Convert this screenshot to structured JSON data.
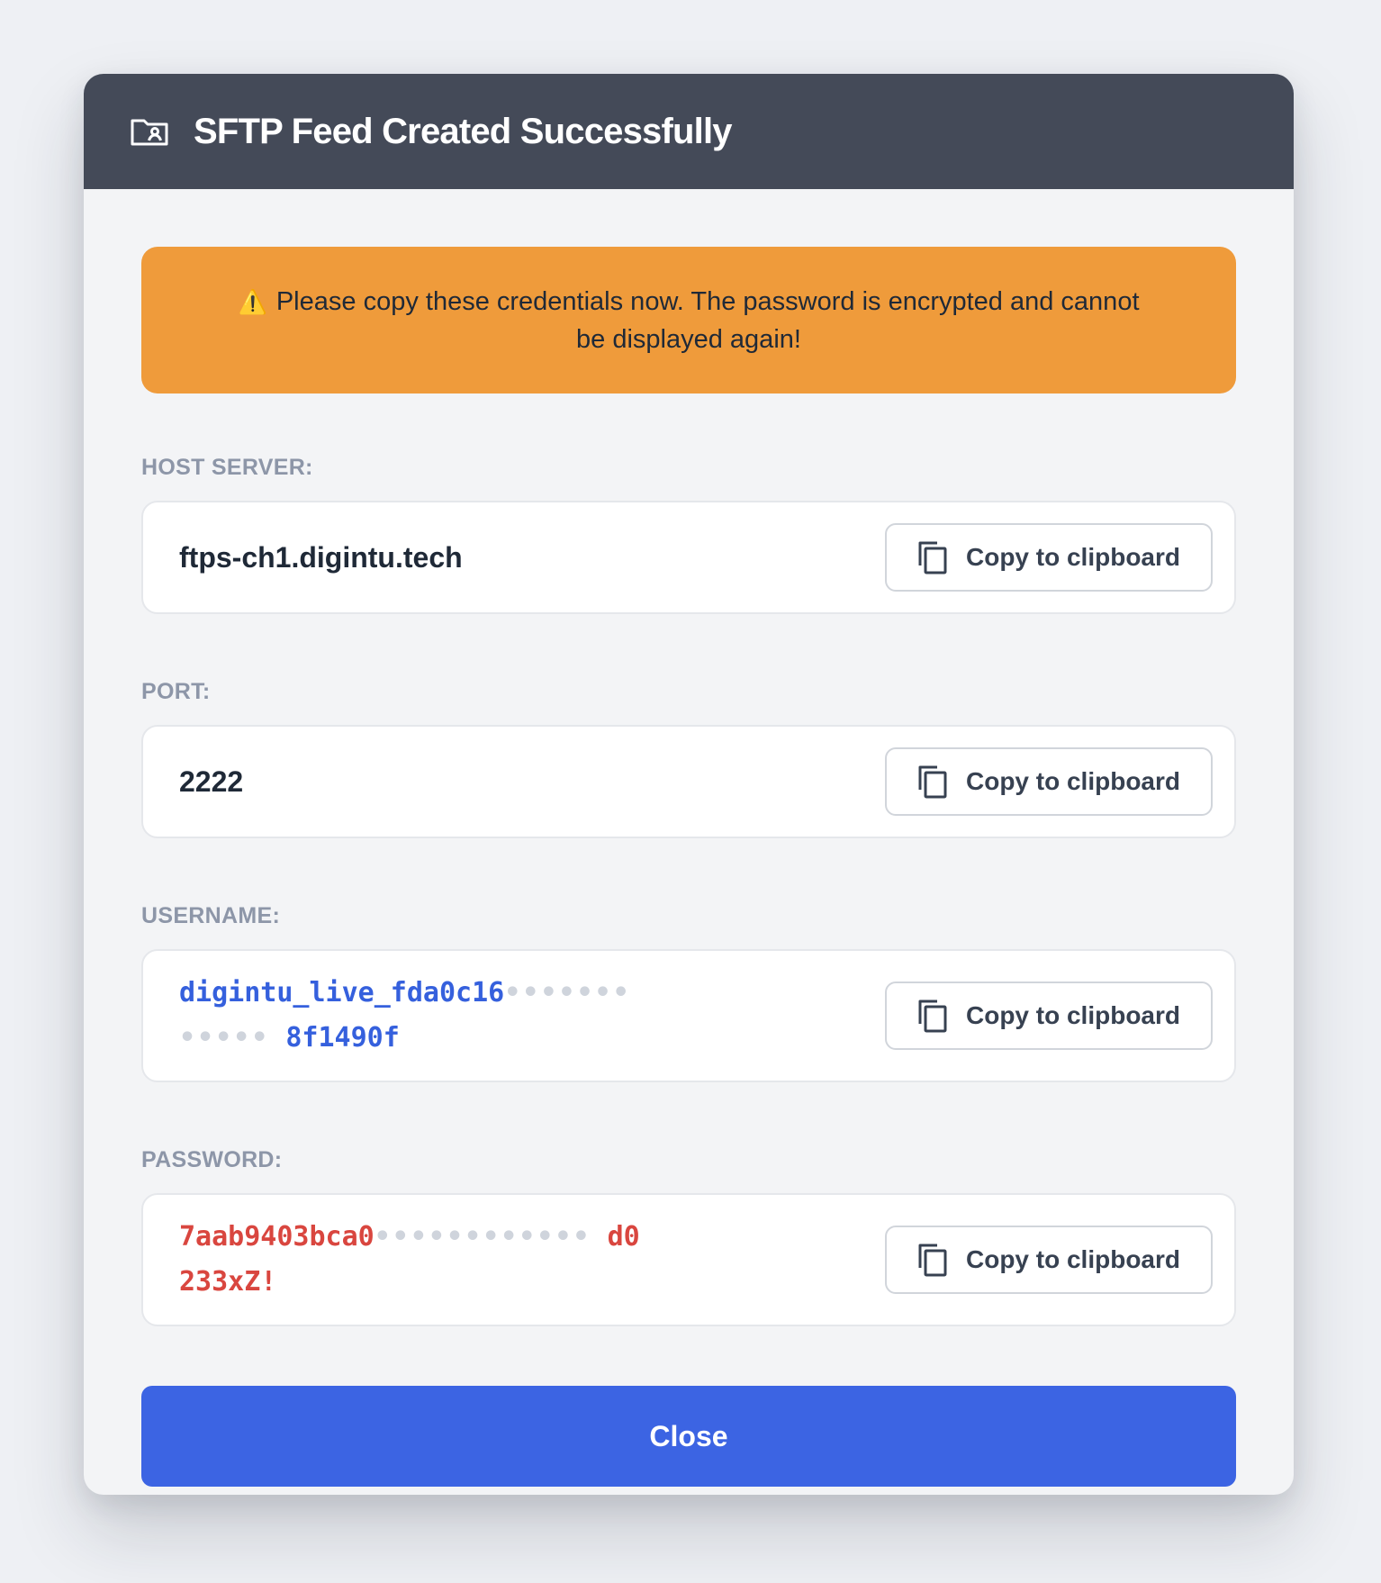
{
  "header": {
    "icon": "folder-user-icon",
    "title": "SFTP Feed Created Successfully"
  },
  "warning": {
    "icon": "⚠️",
    "text": "Please copy these credentials now. The password is encrypted and cannot be displayed again!"
  },
  "fields": [
    {
      "label": "HOST SERVER:",
      "value": "ftps-ch1.digintu.tech"
    },
    {
      "label": "PORT:",
      "value": "2222"
    },
    {
      "label": "USERNAME:",
      "value_line1_prefix": "digintu_live_fda0c16",
      "value_line1_dots": "•••••••",
      "value_line2_dots": "•••••",
      "value_line2_suffix": "8f1490f"
    },
    {
      "label": "PASSWORD:",
      "value_line1_prefix": "7aab9403bca0",
      "value_line1_dots": "••••••••••••",
      "value_line1_suffix": "d0",
      "value_line2": "233xZ!"
    }
  ],
  "copy_button_label": "Copy to clipboard",
  "close_button_label": "Close",
  "colors": {
    "header_bg": "#444a58",
    "warning_bg": "#ef9b3b",
    "primary": "#3c64e3",
    "username_text": "#3560dd",
    "password_text": "#d9463f"
  }
}
